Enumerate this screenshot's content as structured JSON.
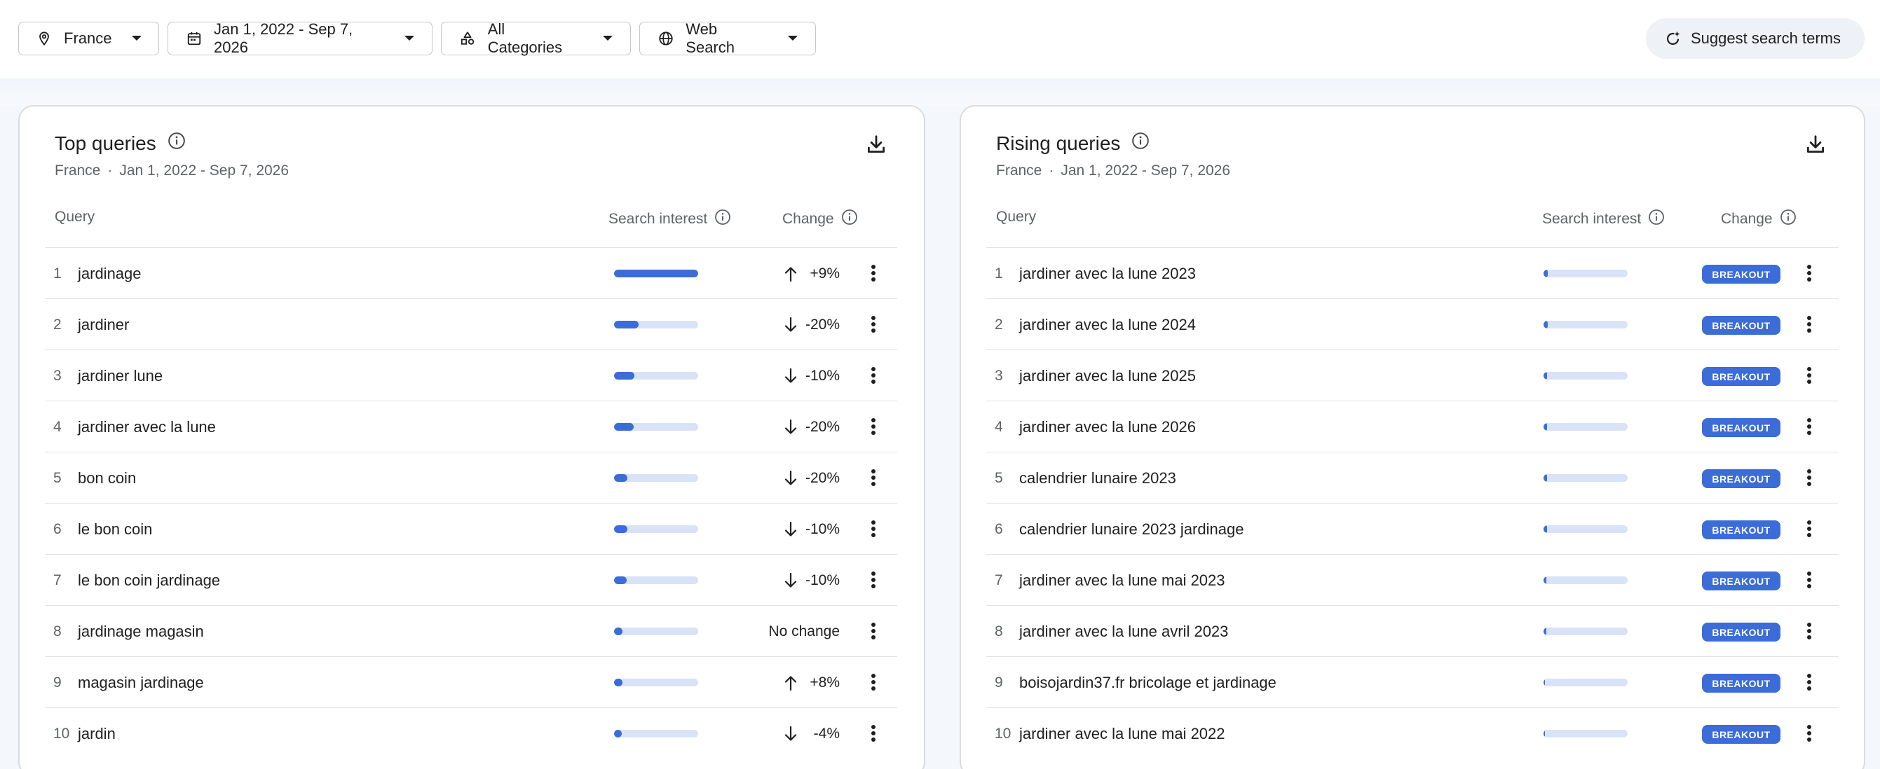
{
  "filters": {
    "location": "France",
    "date_range": "Jan 1, 2022 - Sep 7, 2026",
    "category": "All Categories",
    "search_type": "Web Search",
    "suggest_label": "Suggest search terms"
  },
  "top_queries": {
    "title": "Top queries",
    "subtitle_location": "France",
    "subtitle_separator": "·",
    "subtitle_date": "Jan 1, 2022 - Sep 7, 2026",
    "col_query": "Query",
    "col_interest": "Search interest",
    "col_change": "Change",
    "rows": [
      {
        "rank": "1",
        "query": "jardinage",
        "interest": 100,
        "direction": "up",
        "change": "+9%"
      },
      {
        "rank": "2",
        "query": "jardiner",
        "interest": 29,
        "direction": "down",
        "change": "-20%"
      },
      {
        "rank": "3",
        "query": "jardiner lune",
        "interest": 24,
        "direction": "down",
        "change": "-10%"
      },
      {
        "rank": "4",
        "query": "jardiner avec la lune",
        "interest": 23,
        "direction": "down",
        "change": "-20%"
      },
      {
        "rank": "5",
        "query": "bon coin",
        "interest": 16,
        "direction": "down",
        "change": "-20%"
      },
      {
        "rank": "6",
        "query": "le bon coin",
        "interest": 16,
        "direction": "down",
        "change": "-10%"
      },
      {
        "rank": "7",
        "query": "le bon coin jardinage",
        "interest": 15,
        "direction": "down",
        "change": "-10%"
      },
      {
        "rank": "8",
        "query": "jardinage magasin",
        "interest": 10,
        "direction": "none",
        "change": "No change"
      },
      {
        "rank": "9",
        "query": "magasin jardinage",
        "interest": 10,
        "direction": "up",
        "change": "+8%"
      },
      {
        "rank": "10",
        "query": "jardin",
        "interest": 9,
        "direction": "down",
        "change": "-4%"
      }
    ]
  },
  "rising_queries": {
    "title": "Rising queries",
    "subtitle_location": "France",
    "subtitle_separator": "·",
    "subtitle_date": "Jan 1, 2022 - Sep 7, 2026",
    "col_query": "Query",
    "col_interest": "Search interest",
    "col_change": "Change",
    "rows": [
      {
        "rank": "1",
        "query": "jardiner avec la lune 2023",
        "interest": 5,
        "change": "BREAKOUT"
      },
      {
        "rank": "2",
        "query": "jardiner avec la lune 2024",
        "interest": 5,
        "change": "BREAKOUT"
      },
      {
        "rank": "3",
        "query": "jardiner avec la lune 2025",
        "interest": 4,
        "change": "BREAKOUT"
      },
      {
        "rank": "4",
        "query": "jardiner avec la lune 2026",
        "interest": 4,
        "change": "BREAKOUT"
      },
      {
        "rank": "5",
        "query": "calendrier lunaire 2023",
        "interest": 4,
        "change": "BREAKOUT"
      },
      {
        "rank": "6",
        "query": "calendrier lunaire 2023 jardinage",
        "interest": 4,
        "change": "BREAKOUT"
      },
      {
        "rank": "7",
        "query": "jardiner avec la lune mai 2023",
        "interest": 3,
        "change": "BREAKOUT"
      },
      {
        "rank": "8",
        "query": "jardiner avec la lune avril 2023",
        "interest": 3,
        "change": "BREAKOUT"
      },
      {
        "rank": "9",
        "query": "boisojardin37.fr bricolage et jardinage",
        "interest": 2,
        "change": "BREAKOUT"
      },
      {
        "rank": "10",
        "query": "jardiner avec la lune mai 2022",
        "interest": 2,
        "change": "BREAKOUT"
      }
    ]
  },
  "icons": {
    "location": "location-pin-icon",
    "date": "calendar-icon",
    "category": "categories-icon",
    "search_type": "globe-icon",
    "suggest": "sparkle-refresh-icon",
    "download": "download-icon",
    "info": "info-icon",
    "more": "more-vert-icon"
  },
  "colors": {
    "accent": "#3b6cd8",
    "bar_track": "#d9e3f7",
    "band": "#f4f7fc"
  }
}
